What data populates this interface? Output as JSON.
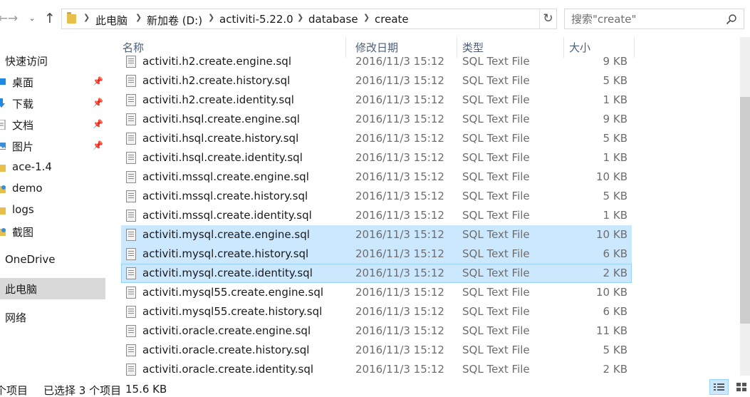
{
  "nav": {
    "back_icon": "arrow-left-icon",
    "forward_icon": "arrow-right-icon",
    "up_icon": "arrow-up-icon"
  },
  "address": {
    "crumbs": [
      "此电脑",
      "新加卷 (D:)",
      "activiti-5.22.0",
      "database",
      "create"
    ]
  },
  "search": {
    "placeholder": "搜索\"create\""
  },
  "sidebar": {
    "items": [
      {
        "label": "快速访问",
        "icon": "star-icon",
        "pinned": false
      },
      {
        "label": "桌面",
        "icon": "desktop-icon",
        "pinned": true
      },
      {
        "label": "下载",
        "icon": "download-icon",
        "pinned": true
      },
      {
        "label": "文档",
        "icon": "document-icon",
        "pinned": true
      },
      {
        "label": "图片",
        "icon": "picture-icon",
        "pinned": true
      },
      {
        "label": "ace-1.4",
        "icon": "folder-icon",
        "pinned": false
      },
      {
        "label": "demo",
        "icon": "folder-icon",
        "pinned": false
      },
      {
        "label": "logs",
        "icon": "folder-icon",
        "pinned": false
      },
      {
        "label": "截图",
        "icon": "folder-icon",
        "pinned": false
      },
      {
        "label": "OneDrive",
        "icon": "cloud-icon",
        "pinned": false
      },
      {
        "label": "此电脑",
        "icon": "computer-icon",
        "pinned": false
      },
      {
        "label": "网络",
        "icon": "network-icon",
        "pinned": false
      }
    ]
  },
  "columns": {
    "name": "名称",
    "date": "修改日期",
    "type": "类型",
    "size": "大小"
  },
  "files": [
    {
      "name": "activiti.h2.create.engine.sql",
      "date": "2016/11/3 15:12",
      "type": "SQL Text File",
      "size": "9 KB"
    },
    {
      "name": "activiti.h2.create.history.sql",
      "date": "2016/11/3 15:12",
      "type": "SQL Text File",
      "size": "5 KB"
    },
    {
      "name": "activiti.h2.create.identity.sql",
      "date": "2016/11/3 15:12",
      "type": "SQL Text File",
      "size": "1 KB"
    },
    {
      "name": "activiti.hsql.create.engine.sql",
      "date": "2016/11/3 15:12",
      "type": "SQL Text File",
      "size": "9 KB"
    },
    {
      "name": "activiti.hsql.create.history.sql",
      "date": "2016/11/3 15:12",
      "type": "SQL Text File",
      "size": "5 KB"
    },
    {
      "name": "activiti.hsql.create.identity.sql",
      "date": "2016/11/3 15:12",
      "type": "SQL Text File",
      "size": "1 KB"
    },
    {
      "name": "activiti.mssql.create.engine.sql",
      "date": "2016/11/3 15:12",
      "type": "SQL Text File",
      "size": "10 KB"
    },
    {
      "name": "activiti.mssql.create.history.sql",
      "date": "2016/11/3 15:12",
      "type": "SQL Text File",
      "size": "5 KB"
    },
    {
      "name": "activiti.mssql.create.identity.sql",
      "date": "2016/11/3 15:12",
      "type": "SQL Text File",
      "size": "1 KB"
    },
    {
      "name": "activiti.mysql.create.engine.sql",
      "date": "2016/11/3 15:12",
      "type": "SQL Text File",
      "size": "10 KB",
      "selected": true
    },
    {
      "name": "activiti.mysql.create.history.sql",
      "date": "2016/11/3 15:12",
      "type": "SQL Text File",
      "size": "6 KB",
      "selected": true
    },
    {
      "name": "activiti.mysql.create.identity.sql",
      "date": "2016/11/3 15:12",
      "type": "SQL Text File",
      "size": "2 KB",
      "selected": true,
      "focused": true
    },
    {
      "name": "activiti.mysql55.create.engine.sql",
      "date": "2016/11/3 15:12",
      "type": "SQL Text File",
      "size": "10 KB"
    },
    {
      "name": "activiti.mysql55.create.history.sql",
      "date": "2016/11/3 15:12",
      "type": "SQL Text File",
      "size": "6 KB"
    },
    {
      "name": "activiti.oracle.create.engine.sql",
      "date": "2016/11/3 15:12",
      "type": "SQL Text File",
      "size": "11 KB"
    },
    {
      "name": "activiti.oracle.create.history.sql",
      "date": "2016/11/3 15:12",
      "type": "SQL Text File",
      "size": "5 KB"
    },
    {
      "name": "activiti.oracle.create.identity.sql",
      "date": "2016/11/3 15:12",
      "type": "SQL Text File",
      "size": "2 KB"
    }
  ],
  "status": {
    "count": "个项目",
    "selection": "已选择 3 个项目",
    "size": "15.6 KB"
  },
  "colors": {
    "selection": "#cce8ff",
    "selection_border": "#99d1ff",
    "header_text": "#4c607a",
    "folder": "#e8bf4a"
  }
}
